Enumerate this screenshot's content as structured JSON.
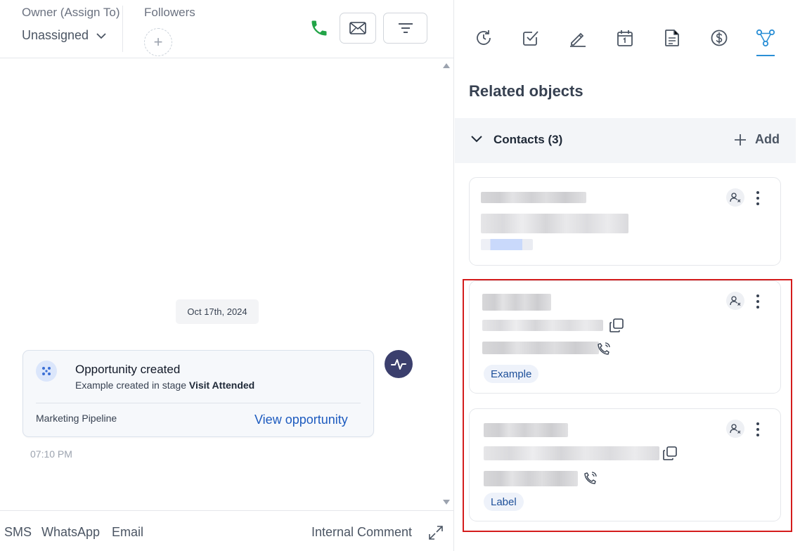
{
  "header": {
    "owner_label": "Owner (Assign To)",
    "owner_value": "Unassigned",
    "followers_label": "Followers",
    "followers_add": "+"
  },
  "timeline": {
    "date": "Oct 17th, 2024",
    "event": {
      "title": "Opportunity created",
      "subtitle_prefix": "Example created in stage ",
      "stage": "Visit Attended",
      "pipeline": "Marketing Pipeline",
      "link": "View opportunity",
      "time": "07:10 PM"
    }
  },
  "composer_tabs": {
    "sms": "SMS",
    "whatsapp": "WhatsApp",
    "email": "Email",
    "internal": "Internal Comment"
  },
  "side_tabs": [
    "activity-history-icon",
    "task-check-icon",
    "pen-note-icon",
    "calendar-icon",
    "document-icon",
    "dollar-icon",
    "related-objects-icon"
  ],
  "related": {
    "title": "Related objects",
    "section_title": "Contacts (3)",
    "add_label": "Add",
    "contacts": [
      {
        "tag": ""
      },
      {
        "tag": "Example"
      },
      {
        "tag": "Label"
      }
    ]
  },
  "colors": {
    "accent_blue": "#1d5bbf",
    "phone_green": "#22a447",
    "active_tab": "#2b8fd6",
    "highlight_red": "#d41c1c"
  }
}
